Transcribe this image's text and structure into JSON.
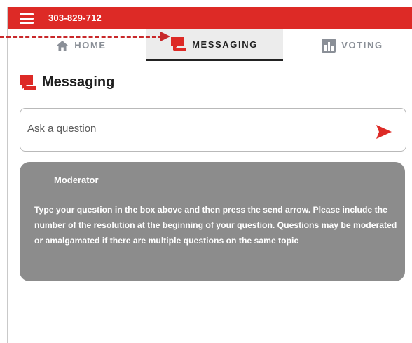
{
  "header": {
    "meeting_id": "303-829-712"
  },
  "tabs": [
    {
      "label": "HOME",
      "icon": "home-icon"
    },
    {
      "label": "MESSAGING",
      "icon": "chat-icon",
      "active": true
    },
    {
      "label": "VOTING",
      "icon": "bar-chart-icon"
    }
  ],
  "section": {
    "title": "Messaging"
  },
  "question": {
    "placeholder": "Ask a question",
    "value": ""
  },
  "moderator": {
    "name": "Moderator",
    "message": "Type your question in the box above and then press the send arrow. Please include the number of the resolution at the beginning of your question. Questions may be moderated or amalgamated if there are multiple questions on the same topic"
  },
  "colors": {
    "brand_red": "#dd2a26",
    "card_gray": "#8c8c8c",
    "tab_inactive": "#8a8f97",
    "annotation_red": "#c8282a"
  }
}
